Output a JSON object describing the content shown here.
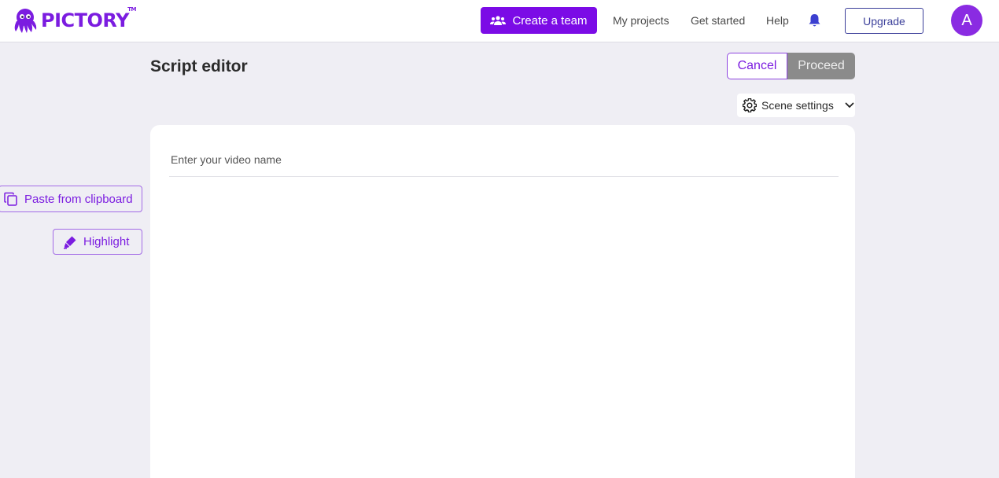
{
  "header": {
    "logo_text": "PICTORY",
    "logo_tm": "TM",
    "create_team_label": "Create a team",
    "nav": [
      "My projects",
      "Get started",
      "Help"
    ],
    "upgrade_label": "Upgrade",
    "avatar_letter": "A"
  },
  "page": {
    "title": "Script editor",
    "cancel_label": "Cancel",
    "proceed_label": "Proceed",
    "scene_settings_label": "Scene settings"
  },
  "side": {
    "paste_label": "Paste from clipboard",
    "highlight_label": "Highlight"
  },
  "editor": {
    "video_name_placeholder": "Enter your video name",
    "video_name_value": ""
  },
  "colors": {
    "brand": "#7b0be6",
    "proceed_disabled": "#8b8b8b",
    "upgrade_border": "#3b3f9a",
    "background": "#efeef4"
  },
  "icons": {
    "logo": "octopus-logo-icon",
    "team": "team-icon",
    "bell": "bell-icon",
    "settings": "gear-icon",
    "chevron": "chevron-down-icon",
    "paste": "copy-icon",
    "highlight": "highlighter-icon"
  }
}
